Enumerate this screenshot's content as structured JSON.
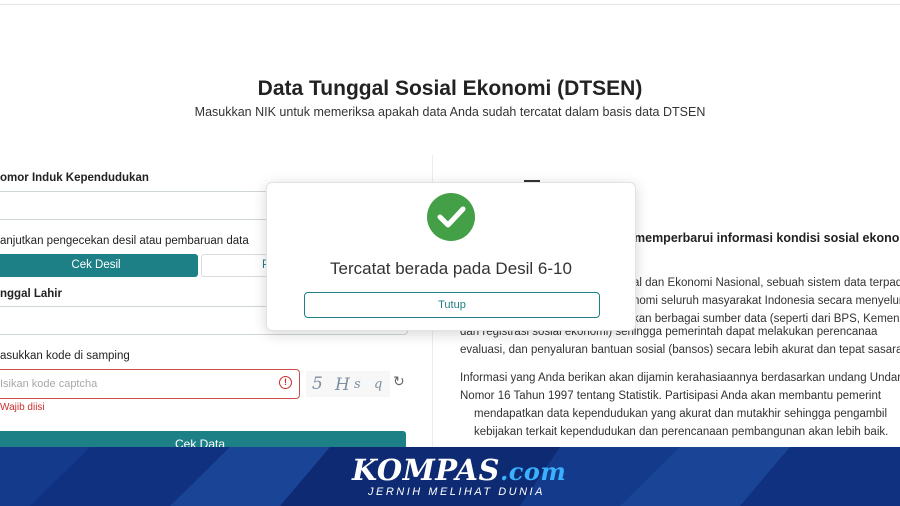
{
  "page": {
    "title": "Data Tunggal Sosial Ekonomi (DTSEN)",
    "subtitle": "Masukkan NIK untuk memeriksa apakah data Anda sudah tercatat dalam basis data DTSEN"
  },
  "form": {
    "nik_label": "omor Induk Kependudukan",
    "continue_label": "anjutkan pengecekan desil atau pembaruan data",
    "cek_desil": "Cek Desil",
    "second_option_partial": "P",
    "dob_label": "nggal Lahir",
    "captcha_label": "asukkan kode di samping",
    "captcha_placeholder": "Isikan kode captcha",
    "captcha_error": "Wajib diisi",
    "captcha_chars": [
      "5",
      "H",
      "s",
      "q"
    ],
    "submit": "Cek Data"
  },
  "info": {
    "heading_partial": "memperbarui informasi kondisi sosial ekonor",
    "line1_partial": "al dan Ekonomi Nasional, sebuah sistem data terpad",
    "line2_partial": "nomi seluruh masyarakat Indonesia secara menyeluru",
    "line3_partial": "kan berbagai sumber data (seperti dari BPS, Kemenso",
    "line4": "dan registrasi sosial ekonomi) sehingga pemerintah dapat melakukan perencanaa",
    "line5": "evaluasi, dan penyaluran bantuan sosial (bansos) secara lebih akurat dan tepat sasaran.",
    "p2_line1": "Informasi yang Anda berikan akan dijamin kerahasiaannya berdasarkan undang Undar",
    "p2_line2": "Nomor 16 Tahun 1997 tentang Statistik. Partisipasi Anda akan membantu pemerint",
    "p2_line3": "mendapatkan data kependudukan yang akurat dan mutakhir sehingga pengambil",
    "p2_line4": "kebijakan terkait kependudukan dan perencanaan pembangunan akan lebih baik."
  },
  "modal": {
    "message": "Tercatat berada pada Desil 6-10",
    "close": "Tutup",
    "icon": "check-circle-icon",
    "icon_color": "#43a047"
  },
  "banner": {
    "brand_main": "KOMPAS",
    "brand_suffix": ".com",
    "tagline": "JERNIH MELIHAT DUNIA"
  }
}
